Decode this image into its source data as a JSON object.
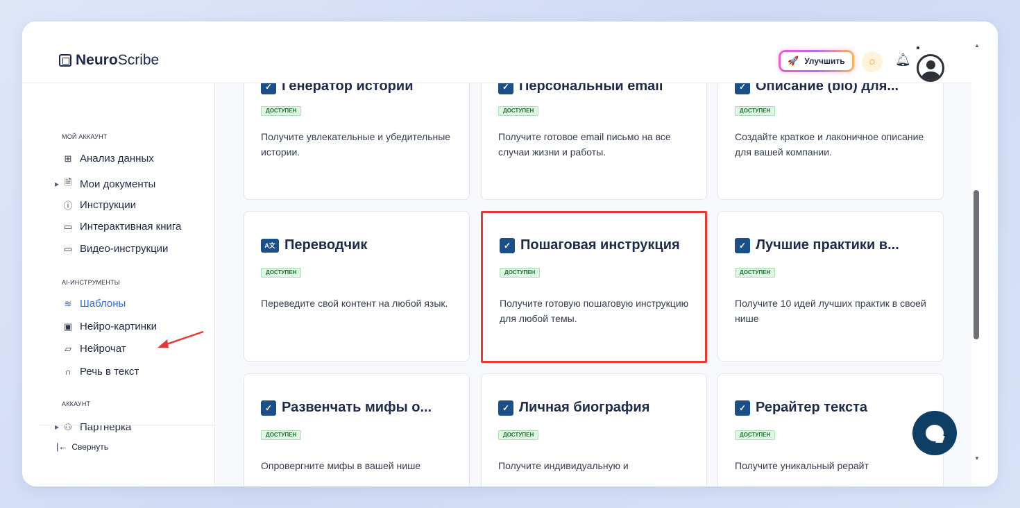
{
  "brand": {
    "bold": "Neuro",
    "rest": "Scribe"
  },
  "header": {
    "upgrade_label": "Улучшить"
  },
  "sidebar": {
    "section_account": "МОЙ АККАУНТ",
    "items_account": [
      {
        "label": "Анализ данных",
        "icon": "grid-icon"
      },
      {
        "label": "Мои документы",
        "icon": "document-icon"
      },
      {
        "label": "Инструкции",
        "icon": "help-circle-icon"
      },
      {
        "label": "Интерактивная книга",
        "icon": "book-icon"
      },
      {
        "label": "Видео-инструкции",
        "icon": "video-icon"
      }
    ],
    "section_ai": "AI-ИНСТРУМЕНТЫ",
    "items_ai": [
      {
        "label": "Шаблоны",
        "icon": "layers-icon"
      },
      {
        "label": "Нейро-картинки",
        "icon": "image-icon"
      },
      {
        "label": "Нейрочат",
        "icon": "chat-icon"
      },
      {
        "label": "Речь в текст",
        "icon": "headphones-icon"
      }
    ],
    "section_acc2": "АККАУНТ",
    "items_acc2": [
      {
        "label": "Партнерка",
        "icon": "users-icon"
      }
    ],
    "collapse_label": "Свернуть"
  },
  "badge_label": "ДОСТУПЕН",
  "cards": [
    {
      "title": "Генератор истории",
      "desc": "Получите увлекательные и убедительные истории."
    },
    {
      "title": "Персональный email",
      "desc": "Получите готовое email письмо на все случаи жизни и работы."
    },
    {
      "title": "Описание (bio) для...",
      "desc": "Создайте краткое и лаконичное описание для вашей компании."
    },
    {
      "title": "Переводчик",
      "desc": "Переведите свой контент на любой язык.",
      "icon_text": "A文"
    },
    {
      "title": "Пошаговая инструкция",
      "desc": "Получите готовую пошаговую инструкцию для любой темы."
    },
    {
      "title": "Лучшие практики в...",
      "desc": "Получите 10 идей лучших практик в своей нише"
    },
    {
      "title": "Развенчать мифы о...",
      "desc": "Опровергните мифы в вашей нише"
    },
    {
      "title": "Личная биография",
      "desc": "Получите индивидуальную и"
    },
    {
      "title": "Рерайтер текста",
      "desc": "Получите уникальный рерайт"
    }
  ],
  "colors": {
    "accent": "#2d6cdf",
    "highlight": "#e53935",
    "badge_bg": "#dff7e3",
    "chat": "#0e3e63"
  }
}
